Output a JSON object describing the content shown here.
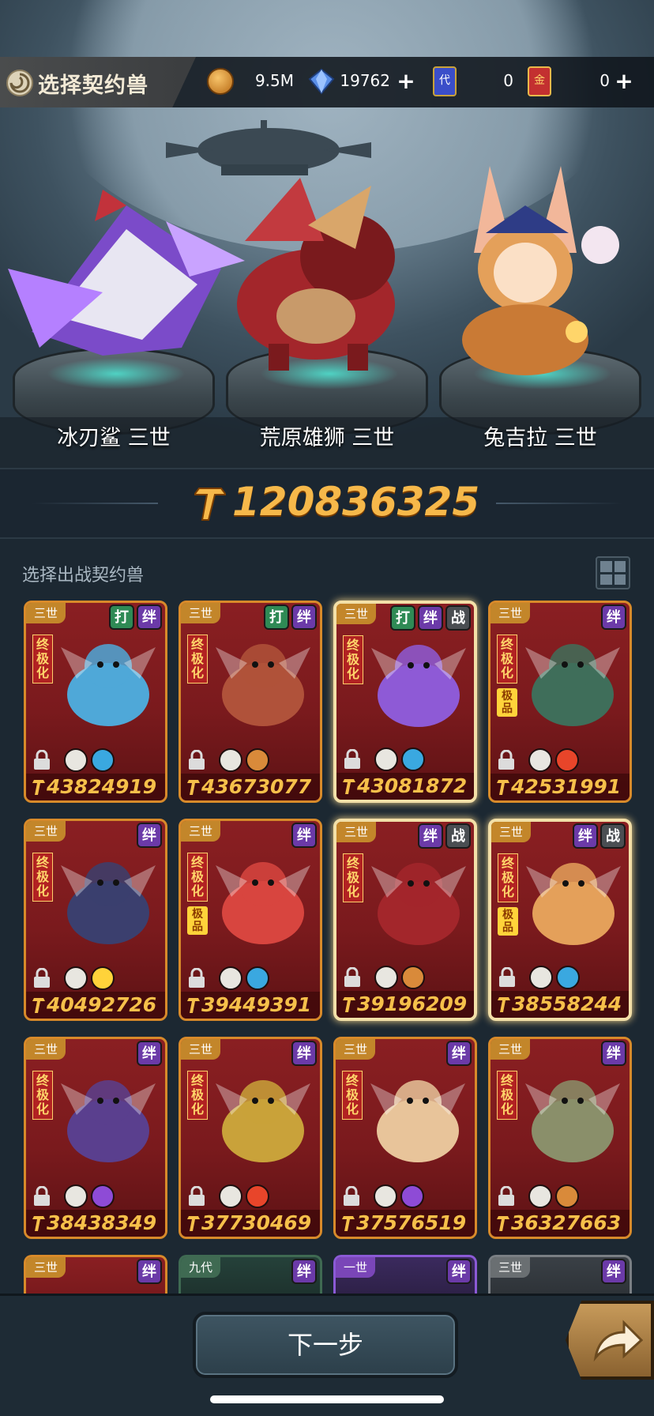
{
  "header": {
    "title": "选择契约兽",
    "resources": [
      {
        "name": "coin",
        "icon": "coin-icon",
        "value": "9.5M",
        "has_plus": false
      },
      {
        "name": "diamond",
        "icon": "diamond-icon",
        "value": "19762",
        "has_plus": true
      },
      {
        "name": "summon-card",
        "icon": "summon-card-icon",
        "icon_text": "代",
        "value": "0",
        "has_plus": false
      },
      {
        "name": "gold-card",
        "icon": "gold-card-icon",
        "icon_text": "金",
        "value": "0",
        "has_plus": true
      }
    ]
  },
  "team": [
    {
      "name": "冰刃鲨 三世",
      "color": "#7b4bc9"
    },
    {
      "name": "荒原雄狮 三世",
      "color": "#a3262b"
    },
    {
      "name": "兔吉拉 三世",
      "color": "#e4a05a"
    }
  ],
  "total_power": "120836325",
  "list": {
    "label": "选择出战契约兽",
    "cards": [
      {
        "tier": "三世",
        "tags": [
          "打",
          "绊"
        ],
        "rank": "终极化",
        "quality": "",
        "power": "43824919",
        "selected": false,
        "elements": [
          "fist-icon",
          "water-icon"
        ],
        "art_color": "#4fa8d8"
      },
      {
        "tier": "三世",
        "tags": [
          "打",
          "绊"
        ],
        "rank": "终极化",
        "quality": "",
        "power": "43673077",
        "selected": false,
        "elements": [
          "eye-icon",
          "earth-icon"
        ],
        "art_color": "#b0523a"
      },
      {
        "tier": "三世",
        "tags": [
          "打",
          "绊",
          "战"
        ],
        "rank": "终极化",
        "quality": "",
        "power": "43081872",
        "selected": true,
        "elements": [
          "spirit-icon",
          "water-icon"
        ],
        "art_color": "#8e5ad6"
      },
      {
        "tier": "三世",
        "tags": [
          "绊"
        ],
        "rank": "终极化",
        "quality": "极品",
        "power": "42531991",
        "selected": false,
        "elements": [
          "spirit-icon",
          "fire-icon"
        ],
        "art_color": "#3f6e5a"
      },
      {
        "tier": "三世",
        "tags": [
          "绊"
        ],
        "rank": "终极化",
        "quality": "",
        "power": "40492726",
        "selected": false,
        "elements": [
          "eye-icon",
          "light-icon"
        ],
        "art_color": "#3b3f6e"
      },
      {
        "tier": "三世",
        "tags": [
          "绊"
        ],
        "rank": "终极化",
        "quality": "极品",
        "power": "39449391",
        "selected": false,
        "elements": [
          "eye-icon",
          "water-icon"
        ],
        "art_color": "#d8453f"
      },
      {
        "tier": "三世",
        "tags": [
          "绊",
          "战"
        ],
        "rank": "终极化",
        "quality": "",
        "power": "39196209",
        "selected": true,
        "elements": [
          "fist-icon",
          "earth-icon"
        ],
        "art_color": "#a3262b"
      },
      {
        "tier": "三世",
        "tags": [
          "绊",
          "战"
        ],
        "rank": "终极化",
        "quality": "极品",
        "power": "38558244",
        "selected": true,
        "elements": [
          "shield-icon",
          "water-icon"
        ],
        "art_color": "#e4a05a"
      },
      {
        "tier": "三世",
        "tags": [
          "绊"
        ],
        "rank": "终极化",
        "quality": "",
        "power": "38438349",
        "selected": false,
        "elements": [
          "eye-icon",
          "dark-icon"
        ],
        "art_color": "#5a3f8e"
      },
      {
        "tier": "三世",
        "tags": [
          "绊"
        ],
        "rank": "终极化",
        "quality": "",
        "power": "37730469",
        "selected": false,
        "elements": [
          "tower-icon",
          "fire-icon"
        ],
        "art_color": "#c9a23a"
      },
      {
        "tier": "三世",
        "tags": [
          "绊"
        ],
        "rank": "终极化",
        "quality": "",
        "power": "37576519",
        "selected": false,
        "elements": [
          "eye-icon",
          "dark-icon"
        ],
        "art_color": "#e8c49a"
      },
      {
        "tier": "三世",
        "tags": [
          "绊"
        ],
        "rank": "终极化",
        "quality": "",
        "power": "36327663",
        "selected": false,
        "elements": [
          "fist-icon",
          "earth-icon"
        ],
        "art_color": "#8a8f6a"
      }
    ],
    "partial_cards": [
      {
        "tier": "三世",
        "tags": [
          "绊"
        ],
        "style": "orange"
      },
      {
        "tier": "九代",
        "tags": [
          "绊"
        ],
        "style": "green"
      },
      {
        "tier": "一世",
        "tags": [
          "绊"
        ],
        "style": "purple"
      },
      {
        "tier": "三世",
        "tags": [
          "绊"
        ],
        "style": "gray"
      }
    ]
  },
  "footer": {
    "next_label": "下一步",
    "share_icon": "share-arrow-icon"
  }
}
